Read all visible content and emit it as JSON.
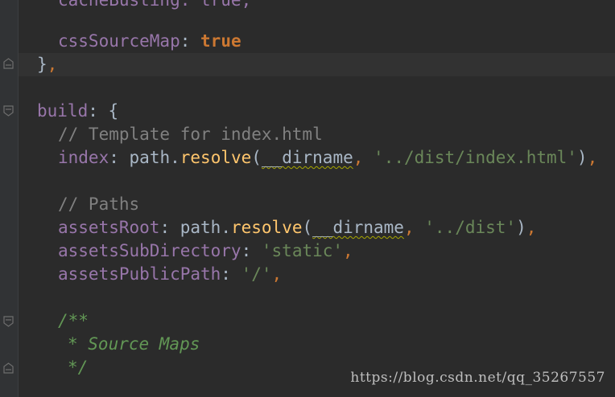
{
  "colors": {
    "background": "#2b2b2b",
    "gutter": "#313335",
    "keyword": "#cc7832",
    "property": "#9876aa",
    "function": "#ffc66d",
    "string": "#6a8759",
    "comment": "#808080",
    "doc_comment": "#629755",
    "text": "#a9b7c6"
  },
  "code": {
    "line_top_cut": "cacheBusting: true,",
    "css_source_map_key": "cssSourceMap",
    "colon": ":",
    "true_value": "true",
    "close_brace": "}",
    "comma": ",",
    "build_key": "build",
    "open_brace": "{",
    "comment_template": "// Template for index.html",
    "index_key": "index",
    "path_obj": "path",
    "dot": ".",
    "resolve_fn": "resolve",
    "open_paren": "(",
    "dirname": "__dirname",
    "index_path": "'../dist/index.html'",
    "close_paren": ")",
    "comment_paths": "// Paths",
    "assets_root_key": "assetsRoot",
    "dist_path": "'../dist'",
    "assets_sub_key": "assetsSubDirectory",
    "static_value": "'static'",
    "assets_public_key": "assetsPublicPath",
    "slash_value": "'/'",
    "doc_open": "/**",
    "doc_source_maps": "* Source Maps",
    "doc_close": "*/"
  },
  "watermark": "https://blog.csdn.net/qq_35267557"
}
